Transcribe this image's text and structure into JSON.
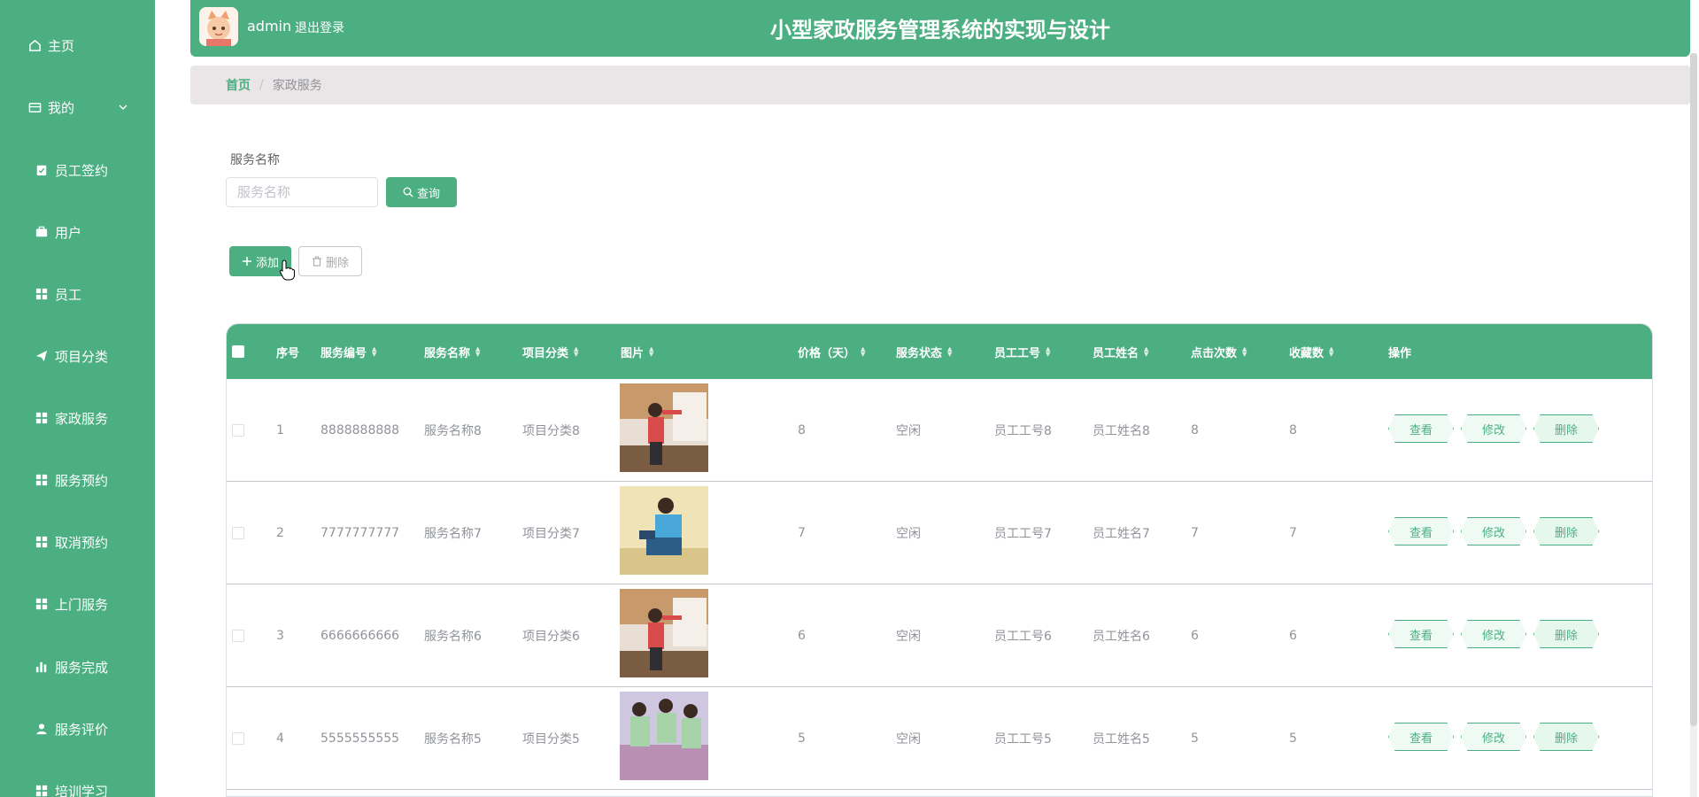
{
  "sidebar": {
    "home": "主页",
    "mine": "我的",
    "items": [
      "员工签约",
      "用户",
      "员工",
      "项目分类",
      "家政服务",
      "服务预约",
      "取消预约",
      "上门服务",
      "服务完成",
      "服务评价",
      "培训学习"
    ]
  },
  "header": {
    "username": "admin",
    "logout": "退出登录",
    "title": "小型家政服务管理系统的实现与设计"
  },
  "breadcrumb": {
    "home": "首页",
    "separator": "/",
    "current": "家政服务"
  },
  "search": {
    "label": "服务名称",
    "placeholder": "服务名称",
    "button": "查询"
  },
  "actions": {
    "add": "添加",
    "delete": "删除"
  },
  "table": {
    "headers": [
      "序号",
      "服务编号",
      "服务名称",
      "项目分类",
      "图片",
      "价格（天）",
      "服务状态",
      "员工工号",
      "员工姓名",
      "点击次数",
      "收藏数",
      "操作"
    ],
    "rows": [
      [
        "1",
        "8888888888",
        "服务名称8",
        "项目分类8",
        "8",
        "空闲",
        "员工工号8",
        "员工姓名8",
        "8",
        "8"
      ],
      [
        "2",
        "7777777777",
        "服务名称7",
        "项目分类7",
        "7",
        "空闲",
        "员工工号7",
        "员工姓名7",
        "7",
        "7"
      ],
      [
        "3",
        "6666666666",
        "服务名称6",
        "项目分类6",
        "6",
        "空闲",
        "员工工号6",
        "员工姓名6",
        "6",
        "6"
      ],
      [
        "4",
        "5555555555",
        "服务名称5",
        "项目分类5",
        "5",
        "空闲",
        "员工工号5",
        "员工姓名5",
        "5",
        "5"
      ]
    ],
    "op_view": "查看",
    "op_edit": "修改",
    "op_delete": "删除"
  },
  "colors": {
    "primary": "#4caf82",
    "breadcrumb_bg": "#eae6e7"
  }
}
